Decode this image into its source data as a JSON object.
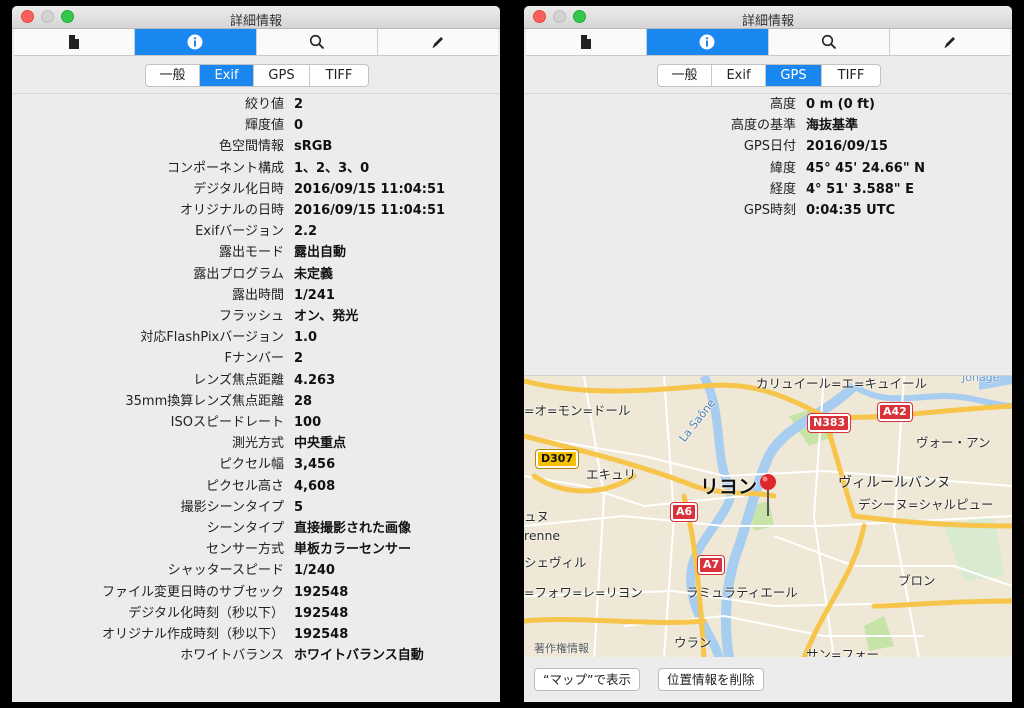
{
  "left_window": {
    "title": "詳細情報",
    "toolbar": [
      {
        "icon": "document-icon",
        "active": false
      },
      {
        "icon": "info-icon",
        "active": true
      },
      {
        "icon": "search-icon",
        "active": false
      },
      {
        "icon": "pencil-icon",
        "active": false
      }
    ],
    "tabs": [
      "一般",
      "Exif",
      "GPS",
      "TIFF"
    ],
    "active_tab": "Exif",
    "rows": [
      {
        "label": "絞り値",
        "value": "2"
      },
      {
        "label": "輝度値",
        "value": "0"
      },
      {
        "label": "色空間情報",
        "value": "sRGB"
      },
      {
        "label": "コンポーネント構成",
        "value": "1、2、3、0"
      },
      {
        "label": "デジタル化日時",
        "value": "2016/09/15 11:04:51"
      },
      {
        "label": "オリジナルの日時",
        "value": "2016/09/15 11:04:51"
      },
      {
        "label": "Exifバージョン",
        "value": "2.2"
      },
      {
        "label": "露出モード",
        "value": "露出自動"
      },
      {
        "label": "露出プログラム",
        "value": "未定義"
      },
      {
        "label": "露出時間",
        "value": "1/241"
      },
      {
        "label": "フラッシュ",
        "value": "オン、発光"
      },
      {
        "label": "対応FlashPixバージョン",
        "value": "1.0"
      },
      {
        "label": "Fナンバー",
        "value": "2"
      },
      {
        "label": "レンズ焦点距離",
        "value": "4.263"
      },
      {
        "label": "35mm換算レンズ焦点距離",
        "value": "28"
      },
      {
        "label": "ISOスピードレート",
        "value": "100"
      },
      {
        "label": "測光方式",
        "value": "中央重点"
      },
      {
        "label": "ピクセル幅",
        "value": "3,456"
      },
      {
        "label": "ピクセル高さ",
        "value": "4,608"
      },
      {
        "label": "撮影シーンタイプ",
        "value": "5"
      },
      {
        "label": "シーンタイプ",
        "value": "直接撮影された画像"
      },
      {
        "label": "センサー方式",
        "value": "単板カラーセンサー"
      },
      {
        "label": "シャッタースピード",
        "value": "1/240"
      },
      {
        "label": "ファイル変更日時のサブセック",
        "value": "192548"
      },
      {
        "label": "デジタル化時刻（秒以下）",
        "value": "192548"
      },
      {
        "label": "オリジナル作成時刻（秒以下）",
        "value": "192548"
      },
      {
        "label": "ホワイトバランス",
        "value": "ホワイトバランス自動"
      }
    ]
  },
  "right_window": {
    "title": "詳細情報",
    "tabs": [
      "一般",
      "Exif",
      "GPS",
      "TIFF"
    ],
    "active_tab": "GPS",
    "rows": [
      {
        "label": "高度",
        "value": "0 m (0 ft)"
      },
      {
        "label": "高度の基準",
        "value": "海抜基準"
      },
      {
        "label": "GPS日付",
        "value": "2016/09/15"
      },
      {
        "label": "緯度",
        "value": "45° 45' 24.66\" N"
      },
      {
        "label": "経度",
        "value": "4° 51' 3.588\" E"
      },
      {
        "label": "GPS時刻",
        "value": "0:04:35 UTC"
      }
    ],
    "map": {
      "labels": {
        "kaluire": "カリュイール=エ=キュイール",
        "mont": "=オ=モン=ドール",
        "saone": "La Saône",
        "ecully": "エキュリ",
        "lyon": "リヨン",
        "villeurbanne": "ヴィルールバンヌ",
        "vaulx": "ヴォー・アン",
        "decines": "デシーヌ=シャルピュー",
        "une": "ュヌ",
        "renne": "renne",
        "sheville": "シェヴィル",
        "foi": "=フォワ=レ=リヨン",
        "mulatiere": "ラミュラティエール",
        "bron": "ブロン",
        "oullins": "ウラン",
        "saint": "サン=フォー",
        "copyright": "著作権情報",
        "jonage": "Jonage"
      },
      "roads": {
        "d307": "D307",
        "n383": "N383",
        "a42": "A42",
        "a6": "A6",
        "a7": "A7"
      },
      "colors": {
        "pin": "#e0262d",
        "water": "#a7cdf0",
        "motorway": "#f6c54a",
        "park": "#c7e3a8"
      }
    },
    "buttons": {
      "show_in_maps": "“マップ”で表示",
      "remove_location": "位置情報を削除"
    }
  }
}
